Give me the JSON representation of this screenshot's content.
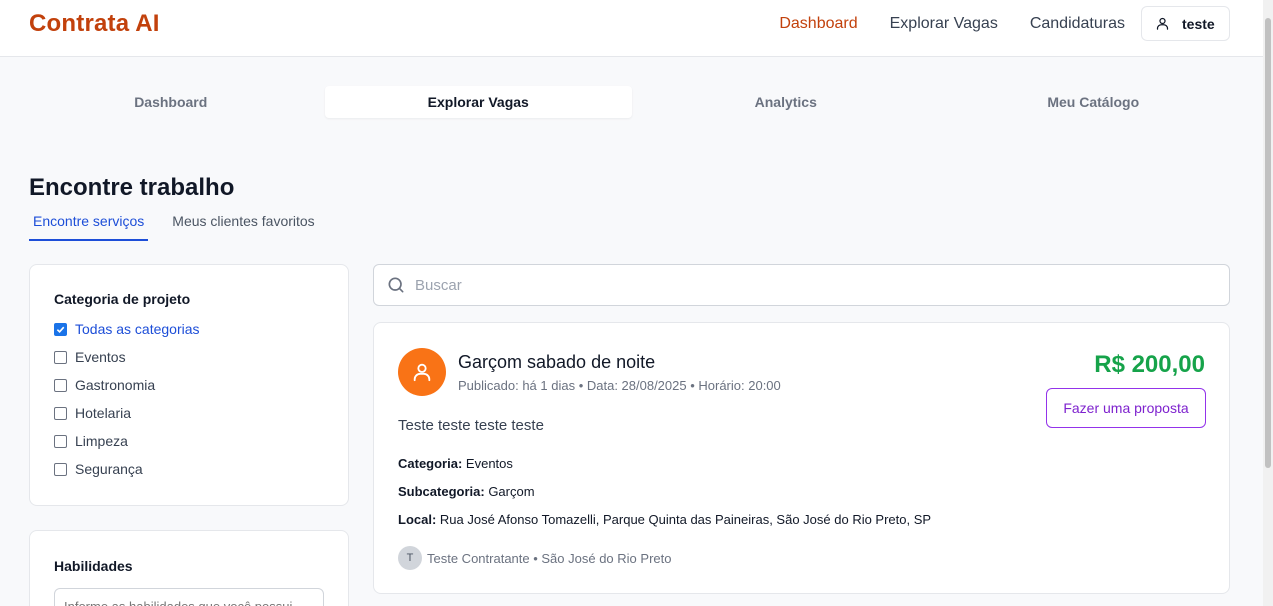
{
  "app": {
    "brand": "Contrata AI"
  },
  "nav": {
    "items": [
      {
        "label": "Dashboard",
        "active": true
      },
      {
        "label": "Explorar Vagas",
        "active": false
      },
      {
        "label": "Candidaturas",
        "active": false
      }
    ],
    "user": {
      "name": "teste",
      "icon": "user-icon"
    }
  },
  "tabs": [
    {
      "label": "Dashboard"
    },
    {
      "label": "Explorar Vagas"
    },
    {
      "label": "Analytics"
    },
    {
      "label": "Meu Catálogo"
    }
  ],
  "page": {
    "title": "Encontre trabalho",
    "subtabs": [
      {
        "label": "Encontre serviços"
      },
      {
        "label": "Meus clientes favoritos"
      }
    ]
  },
  "filters": {
    "category_title": "Categoria de projeto",
    "categories": [
      {
        "label": "Todas as categorias",
        "checked": true
      },
      {
        "label": "Eventos",
        "checked": false
      },
      {
        "label": "Gastronomia",
        "checked": false
      },
      {
        "label": "Hotelaria",
        "checked": false
      },
      {
        "label": "Limpeza",
        "checked": false
      },
      {
        "label": "Segurança",
        "checked": false
      }
    ],
    "skills_title": "Habilidades",
    "skills_placeholder": "Informe as habilidades que você possui"
  },
  "search": {
    "placeholder": "Buscar",
    "value": ""
  },
  "job": {
    "title": "Garçom sabado de noite",
    "meta": "Publicado: há 1 dias • Data: 28/08/2025 • Horário: 20:00",
    "price": "R$ 200,00",
    "proposal_label": "Fazer uma proposta",
    "description": "Teste teste teste teste",
    "category_label": "Categoria:",
    "category": "Eventos",
    "subcategory_label": "Subcategoria:",
    "subcategory": "Garçom",
    "location_label": "Local:",
    "location": "Rua José Afonso Tomazelli, Parque Quinta das Paineiras, São José do Rio Preto, SP",
    "client_initial": "T",
    "client": "Teste Contratante • São José do Rio Preto"
  },
  "colors": {
    "brand": "#c2410c",
    "price": "#16a34a",
    "accent": "#1d4ed8",
    "proposal": "#9333ea",
    "avatar": "#f97316"
  }
}
